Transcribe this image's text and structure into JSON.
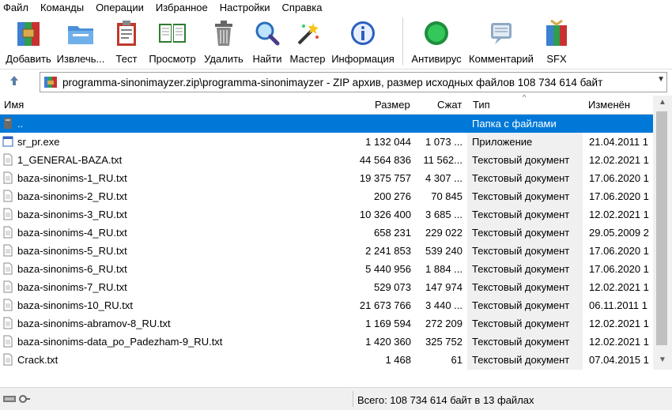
{
  "menu": [
    "Файл",
    "Команды",
    "Операции",
    "Избранное",
    "Настройки",
    "Справка"
  ],
  "toolbar": {
    "add": "Добавить",
    "extract": "Извлечь...",
    "test": "Тест",
    "view": "Просмотр",
    "delete": "Удалить",
    "find": "Найти",
    "wizard": "Мастер",
    "info": "Информация",
    "antivirus": "Антивирус",
    "comment": "Комментарий",
    "sfx": "SFX"
  },
  "address": {
    "path": "programma-sinonimayzer.zip\\programma-sinonimayzer - ZIP архив, размер исходных файлов 108 734 614 байт"
  },
  "columns": {
    "name": "Имя",
    "size": "Размер",
    "packed": "Сжат",
    "type": "Тип",
    "modified": "Изменён"
  },
  "rows": [
    {
      "name": "..",
      "size": "",
      "packed": "",
      "type": "Папка с файлами",
      "modified": "",
      "icon": "folder-up-icon",
      "selected": true
    },
    {
      "name": "sr_pr.exe",
      "size": "1 132 044",
      "packed": "1 073 ...",
      "type": "Приложение",
      "modified": "21.04.2011 1",
      "icon": "exe-icon"
    },
    {
      "name": "1_GENERAL-BAZA.txt",
      "size": "44 564 836",
      "packed": "11 562...",
      "type": "Текстовый документ",
      "modified": "12.02.2021 1",
      "icon": "text-file-icon"
    },
    {
      "name": "baza-sinonims-1_RU.txt",
      "size": "19 375 757",
      "packed": "4 307 ...",
      "type": "Текстовый документ",
      "modified": "17.06.2020 1",
      "icon": "text-file-icon"
    },
    {
      "name": "baza-sinonims-2_RU.txt",
      "size": "200 276",
      "packed": "70 845",
      "type": "Текстовый документ",
      "modified": "17.06.2020 1",
      "icon": "text-file-icon"
    },
    {
      "name": "baza-sinonims-3_RU.txt",
      "size": "10 326 400",
      "packed": "3 685 ...",
      "type": "Текстовый документ",
      "modified": "12.02.2021 1",
      "icon": "text-file-icon"
    },
    {
      "name": "baza-sinonims-4_RU.txt",
      "size": "658 231",
      "packed": "229 022",
      "type": "Текстовый документ",
      "modified": "29.05.2009 2",
      "icon": "text-file-icon"
    },
    {
      "name": "baza-sinonims-5_RU.txt",
      "size": "2 241 853",
      "packed": "539 240",
      "type": "Текстовый документ",
      "modified": "17.06.2020 1",
      "icon": "text-file-icon"
    },
    {
      "name": "baza-sinonims-6_RU.txt",
      "size": "5 440 956",
      "packed": "1 884 ...",
      "type": "Текстовый документ",
      "modified": "17.06.2020 1",
      "icon": "text-file-icon"
    },
    {
      "name": "baza-sinonims-7_RU.txt",
      "size": "529 073",
      "packed": "147 974",
      "type": "Текстовый документ",
      "modified": "12.02.2021 1",
      "icon": "text-file-icon"
    },
    {
      "name": "baza-sinonims-10_RU.txt",
      "size": "21 673 766",
      "packed": "3 440 ...",
      "type": "Текстовый документ",
      "modified": "06.11.2011 1",
      "icon": "text-file-icon"
    },
    {
      "name": "baza-sinonims-abramov-8_RU.txt",
      "size": "1 169 594",
      "packed": "272 209",
      "type": "Текстовый документ",
      "modified": "12.02.2021 1",
      "icon": "text-file-icon"
    },
    {
      "name": "baza-sinonims-data_po_Padezham-9_RU.txt",
      "size": "1 420 360",
      "packed": "325 752",
      "type": "Текстовый документ",
      "modified": "12.02.2021 1",
      "icon": "text-file-icon"
    },
    {
      "name": "Crack.txt",
      "size": "1 468",
      "packed": "61",
      "type": "Текстовый документ",
      "modified": "07.04.2015 1",
      "icon": "text-file-icon"
    }
  ],
  "status": {
    "total": "Всего: 108 734 614 байт в 13 файлах"
  },
  "colors": {
    "selection": "#0078d7",
    "type_column_bg": "#f0f0f0"
  }
}
